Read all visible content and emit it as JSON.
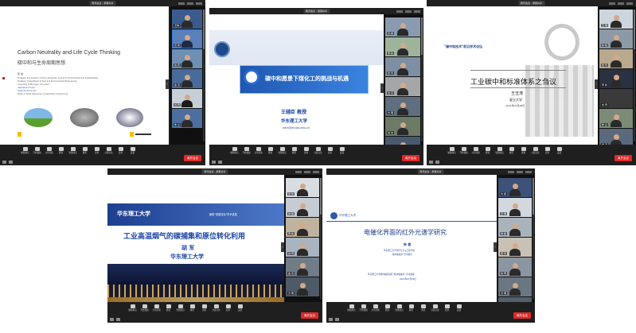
{
  "windows": [
    {
      "id": "w1",
      "title": "腾讯会议 - 屏幕共享",
      "slide": {
        "title_en": "Carbon Neutrality and Life Cycle Thinking",
        "title_cn": "碳中和与生命周期思想",
        "speaker": "匡 旭",
        "lines": [
          "Professor and Director of China Programs, School for Environment and Sustainability",
          "Professor, Department of Civil and Environmental Engineering",
          "University of Michigan, Ann Arbor",
          "miller@umich.edu",
          "www.css.umich.edu",
          "Editor-in-Chief, Resources, Conservation & Recycling"
        ]
      },
      "participants": [
        "王梅",
        "高 军",
        "钱 庆",
        "金 涛",
        "刘 琦",
        "朱 立"
      ]
    },
    {
      "id": "w2",
      "title": "腾讯会议 - 屏幕共享",
      "slide": {
        "title": "碳中和愿景下煤化工的挑战与机遇",
        "speaker": "王辅臣 教授",
        "org": "华东理工大学",
        "email": "wfch@ecust.edu.cn"
      },
      "participants": [
        "孙 娟",
        "李 新",
        "张 华",
        "沈 平",
        "方 明",
        "刘 杰",
        "钟 斌"
      ]
    },
    {
      "id": "w3",
      "title": "腾讯会议 - 屏幕共享",
      "slide": {
        "header": "\"碳中和技术\"前沿学术论坛",
        "title": "工业碳中和标准体系之刍议",
        "speaker": "王玉涛",
        "org": "复旦大学",
        "date": "2021年07月28日"
      },
      "participants": [
        "王 明",
        "钟 斌",
        "张 华",
        "李 新",
        "刘 琦",
        "朱 立",
        "金 涛"
      ]
    },
    {
      "id": "w4",
      "title": "腾讯会议 - 屏幕共享",
      "slide": {
        "banner": "华东理工大学",
        "banner_right": "聚焦\"双碳目标\"学术讲座",
        "title": "工业高温烟气的碳捕集和原位转化利用",
        "speaker": "胡 军",
        "org": "华东理工大学"
      },
      "participants": [
        "张 华",
        "钟 斌",
        "李 新",
        "刘 琦",
        "金 涛",
        "方 明"
      ]
    },
    {
      "id": "w5",
      "title": "腾讯会议 - 屏幕共享",
      "slide": {
        "logo_text": "华东理工大学",
        "title": "电催化界面的红外光谱学研究",
        "speaker": "朱 俊",
        "lines": [
          "华东理工大学化学与分子工程学院",
          "\"碳中和技术\"学术报告"
        ],
        "footer": [
          "华东理工大学碳中和研究院 \"碳中和技术\" 学术讲座",
          "2021年07月28日"
        ]
      },
      "participants": [
        "孙 娟",
        "王 明",
        "钟 斌",
        "张 华",
        "刘 琦",
        "方 明",
        "金 涛"
      ]
    }
  ],
  "toolbar": [
    "解除静音",
    "开启视频",
    "共享屏幕",
    "邀请",
    "管理成员",
    "聊天",
    "录制",
    "分组讨论",
    "应用",
    "设置"
  ],
  "leave_label": "离开会议"
}
